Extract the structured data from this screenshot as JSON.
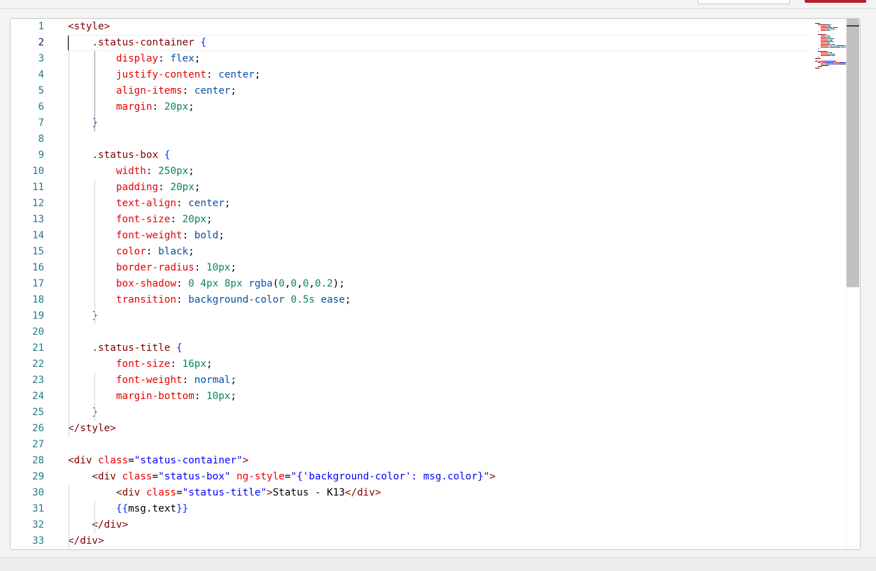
{
  "editor": {
    "active_line": 2,
    "lines": [
      [
        [
          "tag",
          "<style>"
        ]
      ],
      [
        [
          "sel",
          "    .status-container "
        ],
        [
          "brace",
          "{"
        ]
      ],
      [
        [
          "prop",
          "        display"
        ],
        [
          "text",
          ": "
        ],
        [
          "val",
          "flex"
        ],
        [
          "text",
          ";"
        ]
      ],
      [
        [
          "prop",
          "        justify-content"
        ],
        [
          "text",
          ": "
        ],
        [
          "val",
          "center"
        ],
        [
          "text",
          ";"
        ]
      ],
      [
        [
          "prop",
          "        align-items"
        ],
        [
          "text",
          ": "
        ],
        [
          "val",
          "center"
        ],
        [
          "text",
          ";"
        ]
      ],
      [
        [
          "prop",
          "        margin"
        ],
        [
          "text",
          ": "
        ],
        [
          "num",
          "20px"
        ],
        [
          "text",
          ";"
        ]
      ],
      [
        [
          "brace",
          "    }"
        ]
      ],
      [],
      [
        [
          "sel",
          "    .status-box "
        ],
        [
          "brace",
          "{"
        ]
      ],
      [
        [
          "prop",
          "        width"
        ],
        [
          "text",
          ": "
        ],
        [
          "num",
          "250px"
        ],
        [
          "text",
          ";"
        ]
      ],
      [
        [
          "prop",
          "        padding"
        ],
        [
          "text",
          ": "
        ],
        [
          "num",
          "20px"
        ],
        [
          "text",
          ";"
        ]
      ],
      [
        [
          "prop",
          "        text-align"
        ],
        [
          "text",
          ": "
        ],
        [
          "val",
          "center"
        ],
        [
          "text",
          ";"
        ]
      ],
      [
        [
          "prop",
          "        font-size"
        ],
        [
          "text",
          ": "
        ],
        [
          "num",
          "20px"
        ],
        [
          "text",
          ";"
        ]
      ],
      [
        [
          "prop",
          "        font-weight"
        ],
        [
          "text",
          ": "
        ],
        [
          "val",
          "bold"
        ],
        [
          "text",
          ";"
        ]
      ],
      [
        [
          "prop",
          "        color"
        ],
        [
          "text",
          ": "
        ],
        [
          "val",
          "black"
        ],
        [
          "text",
          ";"
        ]
      ],
      [
        [
          "prop",
          "        border-radius"
        ],
        [
          "text",
          ": "
        ],
        [
          "num",
          "10px"
        ],
        [
          "text",
          ";"
        ]
      ],
      [
        [
          "prop",
          "        box-shadow"
        ],
        [
          "text",
          ": "
        ],
        [
          "num",
          "0"
        ],
        [
          "text",
          " "
        ],
        [
          "num",
          "4px"
        ],
        [
          "text",
          " "
        ],
        [
          "num",
          "8px"
        ],
        [
          "text",
          " "
        ],
        [
          "val",
          "rgba"
        ],
        [
          "text",
          "("
        ],
        [
          "num",
          "0"
        ],
        [
          "text",
          ","
        ],
        [
          "num",
          "0"
        ],
        [
          "text",
          ","
        ],
        [
          "num",
          "0"
        ],
        [
          "text",
          ","
        ],
        [
          "num",
          "0.2"
        ],
        [
          "text",
          ");"
        ]
      ],
      [
        [
          "prop",
          "        transition"
        ],
        [
          "text",
          ": "
        ],
        [
          "val",
          "background-color"
        ],
        [
          "text",
          " "
        ],
        [
          "num",
          "0.5s"
        ],
        [
          "text",
          " "
        ],
        [
          "val",
          "ease"
        ],
        [
          "text",
          ";"
        ]
      ],
      [
        [
          "brace",
          "    }"
        ]
      ],
      [],
      [
        [
          "sel",
          "    .status-title "
        ],
        [
          "brace",
          "{"
        ]
      ],
      [
        [
          "prop",
          "        font-size"
        ],
        [
          "text",
          ": "
        ],
        [
          "num",
          "16px"
        ],
        [
          "text",
          ";"
        ]
      ],
      [
        [
          "prop",
          "        font-weight"
        ],
        [
          "text",
          ": "
        ],
        [
          "val",
          "normal"
        ],
        [
          "text",
          ";"
        ]
      ],
      [
        [
          "prop",
          "        margin-bottom"
        ],
        [
          "text",
          ": "
        ],
        [
          "num",
          "10px"
        ],
        [
          "text",
          ";"
        ]
      ],
      [
        [
          "brace",
          "    }"
        ]
      ],
      [
        [
          "tag",
          "</style>"
        ]
      ],
      [],
      [
        [
          "tag",
          "<div"
        ],
        [
          "text",
          " "
        ],
        [
          "attr",
          "class"
        ],
        [
          "text",
          "="
        ],
        [
          "str",
          "\"status-container\""
        ],
        [
          "tag",
          ">"
        ]
      ],
      [
        [
          "tag",
          "    <div"
        ],
        [
          "text",
          " "
        ],
        [
          "attr",
          "class"
        ],
        [
          "text",
          "="
        ],
        [
          "str",
          "\"status-box\""
        ],
        [
          "text",
          " "
        ],
        [
          "attr",
          "ng-style"
        ],
        [
          "text",
          "="
        ],
        [
          "str",
          "\"{'background-color': msg.color}\""
        ],
        [
          "tag",
          ">"
        ]
      ],
      [
        [
          "tag",
          "        <div"
        ],
        [
          "text",
          " "
        ],
        [
          "attr",
          "class"
        ],
        [
          "text",
          "="
        ],
        [
          "str",
          "\"status-title\""
        ],
        [
          "tag",
          ">"
        ],
        [
          "text",
          "Status - K13"
        ],
        [
          "tag",
          "</div>"
        ]
      ],
      [
        [
          "brace",
          "        {{"
        ],
        [
          "text",
          "msg.text"
        ],
        [
          "brace",
          "}}"
        ]
      ],
      [
        [
          "tag",
          "    </div>"
        ]
      ],
      [
        [
          "tag",
          "</div>"
        ]
      ]
    ]
  }
}
